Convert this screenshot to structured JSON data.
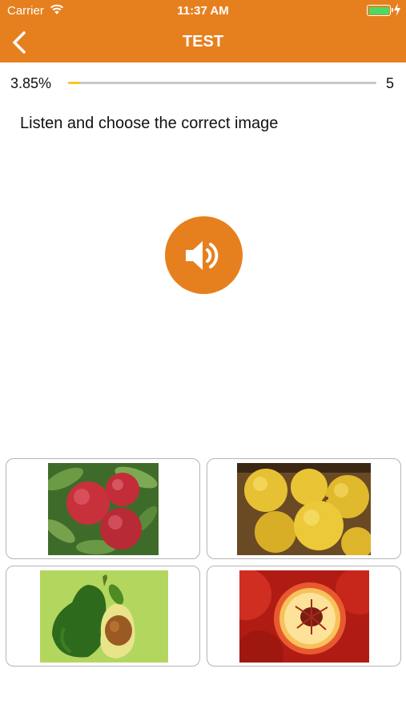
{
  "status_bar": {
    "carrier": "Carrier",
    "time": "11:37 AM"
  },
  "nav": {
    "title": "TEST",
    "back_icon": "chevron-left-icon"
  },
  "progress": {
    "percent_label": "3.85%",
    "fraction": 0.0385,
    "total": "5"
  },
  "question": {
    "instruction": "Listen and choose the correct image",
    "audio_icon": "speaker-icon"
  },
  "options": [
    {
      "depicts": "plums"
    },
    {
      "depicts": "yellow citrus fruits"
    },
    {
      "depicts": "avocado"
    },
    {
      "depicts": "peach"
    }
  ],
  "colors": {
    "accent": "#e6801f",
    "progress_fill": "#f6c623",
    "progress_track": "#c8c8c8",
    "battery": "#4cd964"
  }
}
